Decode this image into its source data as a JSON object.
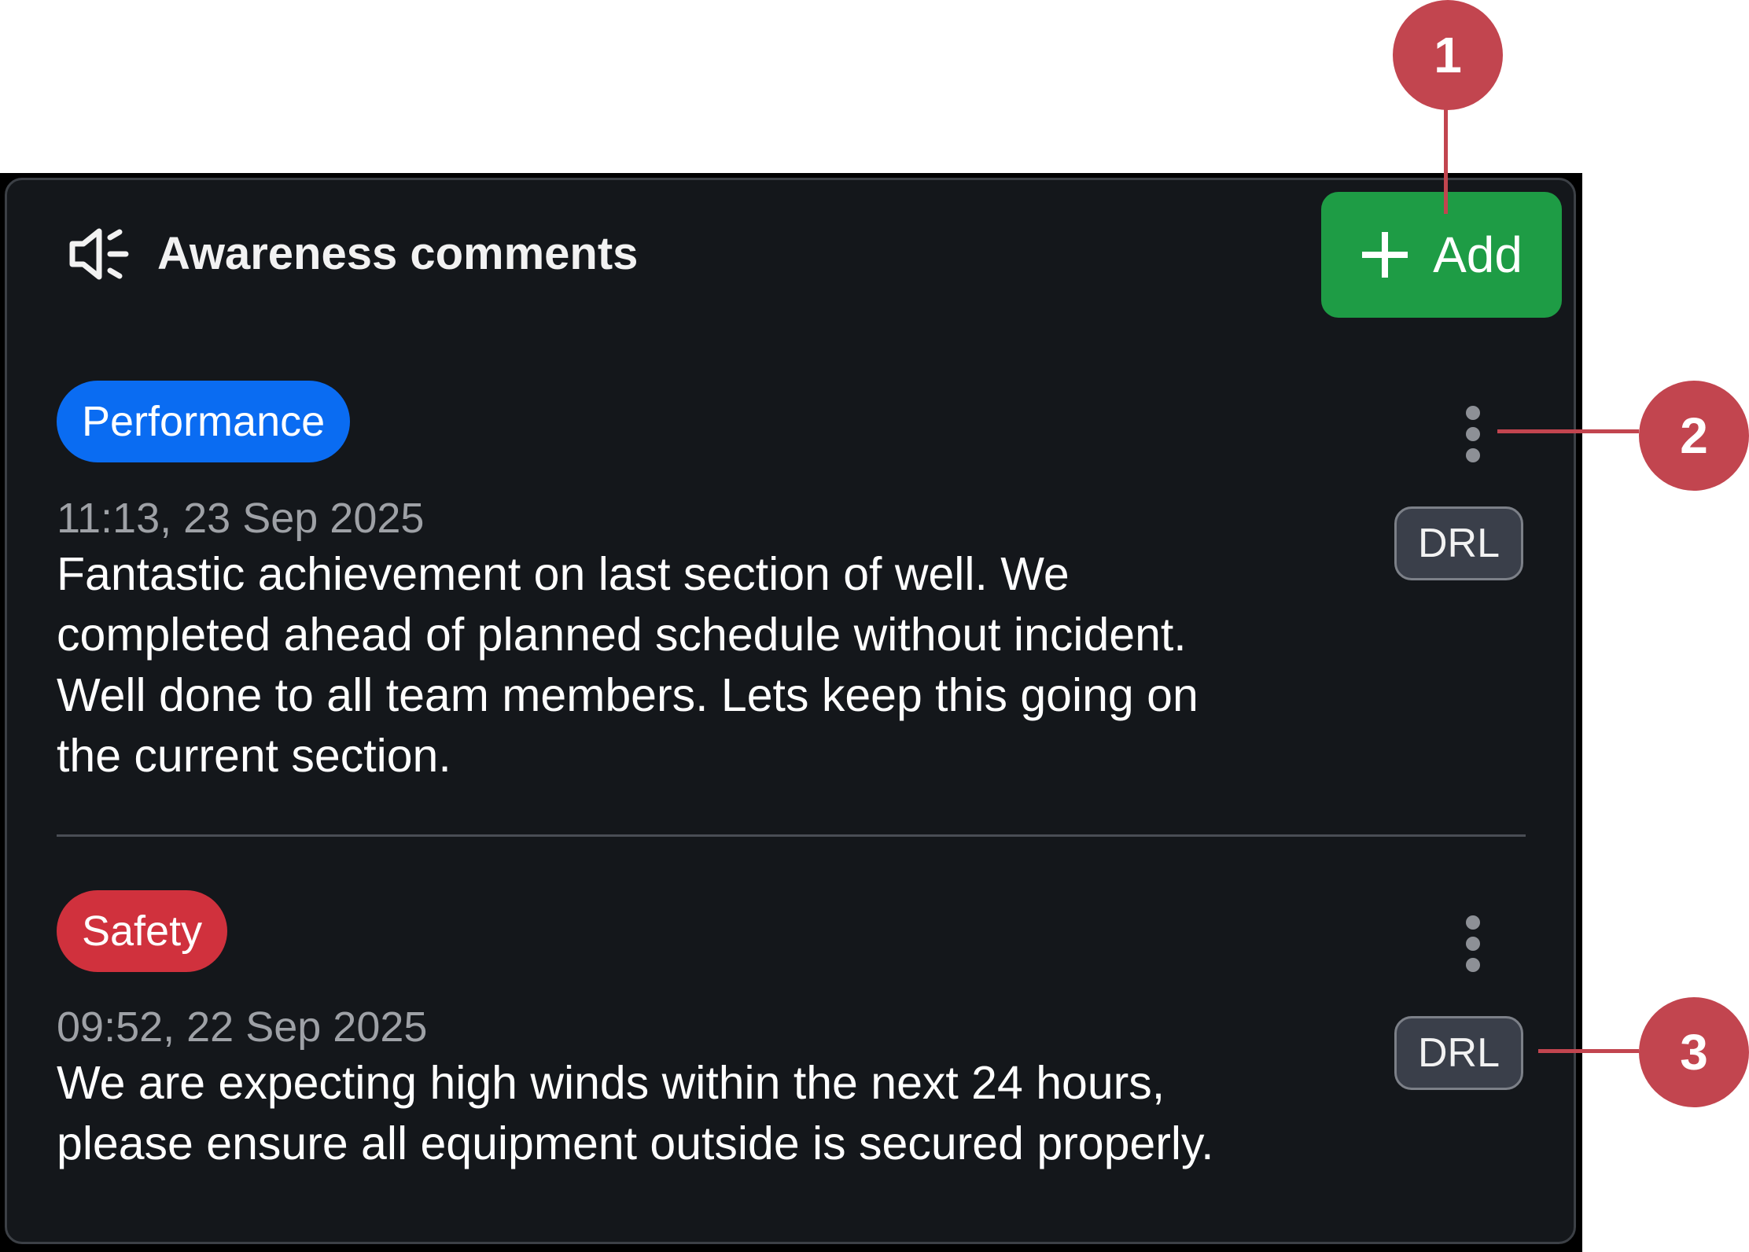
{
  "panel": {
    "title": "Awareness comments",
    "add_label": "Add"
  },
  "comments": [
    {
      "tag": "Performance",
      "tag_color": "#0a6cf2",
      "timestamp": "11:13, 23 Sep 2025",
      "text": "Fantastic achievement on last section of well.  We\ncompleted ahead of planned schedule without incident.\nWell done to all team members.  Lets keep this going on\nthe current section.",
      "badge": "DRL"
    },
    {
      "tag": "Safety",
      "tag_color": "#d0313d",
      "timestamp": "09:52, 22 Sep 2025",
      "text": "We are expecting high winds within the next 24 hours,\nplease ensure all equipment outside is secured properly.",
      "badge": "DRL"
    }
  ],
  "callouts": [
    "1",
    "2",
    "3"
  ],
  "colors": {
    "panel_bg": "#14171b",
    "add_button": "#1e9c45",
    "callout": "#c2454f"
  }
}
